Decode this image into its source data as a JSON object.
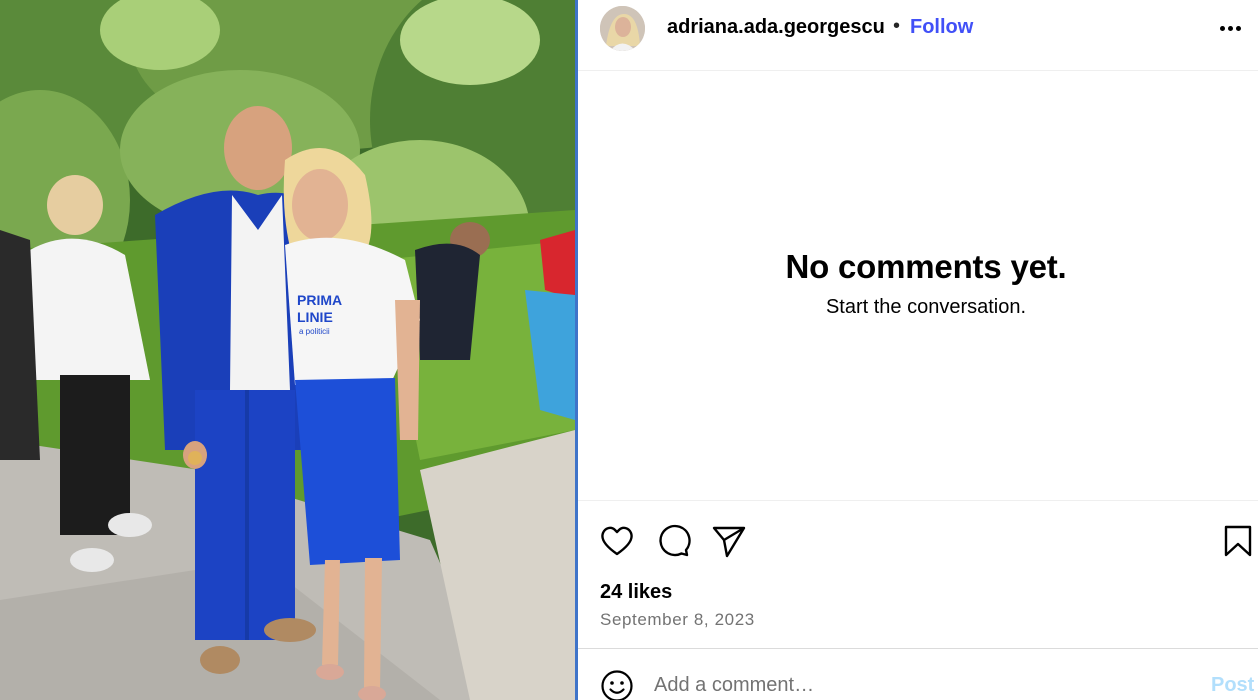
{
  "post": {
    "username": "adriana.ada.georgescu",
    "separator": "•",
    "follow_label": "Follow",
    "more_icon": "more-horizontal-icon",
    "photo_shirt_text": [
      "PRIMA",
      "LINIE",
      "a politicii"
    ]
  },
  "comments": {
    "empty_title": "No comments yet.",
    "empty_subtitle": "Start the conversation."
  },
  "actions": {
    "icons": [
      "heart-icon",
      "comment-icon",
      "share-icon",
      "bookmark-icon"
    ]
  },
  "stats": {
    "likes": "24 likes",
    "date": "September 8, 2023"
  },
  "composer": {
    "placeholder": "Add a comment…",
    "post_label": "Post",
    "emoji_icon": "emoji-icon"
  },
  "colors": {
    "follow_blue": "#4150f7",
    "post_disabled": "#b2dffc",
    "secondary_text": "#737373"
  }
}
